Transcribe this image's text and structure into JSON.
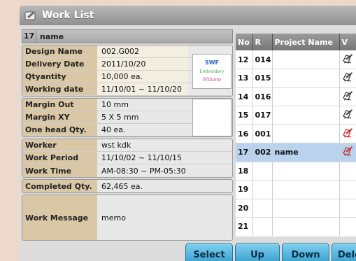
{
  "window": {
    "title": "Work List"
  },
  "job_header": {
    "number": "17",
    "name": "name"
  },
  "fields": {
    "design_name": {
      "label": "Design Name",
      "value": "002.G002"
    },
    "delivery_date": {
      "label": "Delivery Date",
      "value": "2011/10/20"
    },
    "quantity": {
      "label": "Qtyantity",
      "value": "10,000 ea."
    },
    "working_date": {
      "label": "Working date",
      "value": "11/10/01 ~ 11/10/20"
    },
    "margin_out": {
      "label": "Margin Out",
      "value": "10 mm"
    },
    "margin_xy": {
      "label": "Margin XY",
      "value": "5 X 5 mm"
    },
    "one_head_qty": {
      "label": "One head Qty.",
      "value": "40 ea."
    },
    "worker": {
      "label": "Worker",
      "value": "wst kdk"
    },
    "work_period": {
      "label": "Work Period",
      "value": "11/10/02 ~ 11/10/15"
    },
    "work_time": {
      "label": "Work Time",
      "value": "AM-08:30 ~ PM-05:30"
    },
    "completed_qty": {
      "label": "Completed Qty.",
      "value": "62,465 ea."
    },
    "work_message": {
      "label": "Work Message",
      "value": "memo"
    }
  },
  "design_preview": {
    "logo_text": "SWF",
    "line2": "Embroidery",
    "line3": "Wilcom"
  },
  "list": {
    "headers": {
      "no": "No",
      "r": "R",
      "project": "Project Name",
      "v": "V"
    },
    "rows": [
      {
        "no": "12",
        "r": "014",
        "project": "",
        "icon": "pen-note-icon"
      },
      {
        "no": "13",
        "r": "015",
        "project": "",
        "icon": "pen-note-icon"
      },
      {
        "no": "14",
        "r": "016",
        "project": "",
        "icon": "pen-note-icon"
      },
      {
        "no": "15",
        "r": "017",
        "project": "",
        "icon": "pen-note-icon"
      },
      {
        "no": "16",
        "r": "001",
        "project": "",
        "icon": "pen-note-red-icon"
      },
      {
        "no": "17",
        "r": "002",
        "project": "name",
        "icon": "pen-note-red-icon",
        "selected": true
      },
      {
        "no": "18",
        "r": "",
        "project": "",
        "icon": ""
      },
      {
        "no": "19",
        "r": "",
        "project": "",
        "icon": ""
      },
      {
        "no": "20",
        "r": "",
        "project": "",
        "icon": ""
      },
      {
        "no": "21",
        "r": "",
        "project": "",
        "icon": ""
      }
    ]
  },
  "buttons": {
    "select": "Select",
    "up": "Up",
    "down": "Down",
    "delete": "Dele"
  },
  "colors": {
    "button": "#3fa9d6",
    "selected_row": "#b9d3ee",
    "label_tan": "#d9c7a6"
  }
}
